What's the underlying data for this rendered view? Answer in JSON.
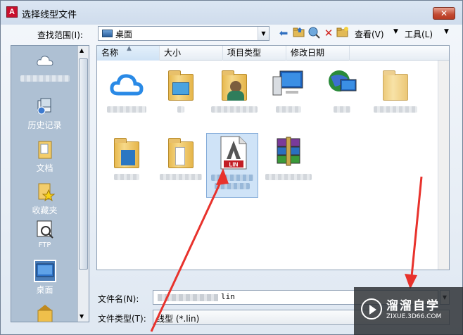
{
  "window": {
    "title": "选择线型文件",
    "app_icon": "A",
    "close_label": "✕"
  },
  "toolbar": {
    "location_label": "查找范围(I):",
    "location_value": "桌面",
    "view_label": "查看(V)",
    "tools_label": "工具(L)",
    "icons": [
      "back-icon",
      "up-folder-icon",
      "search-web-icon",
      "delete-icon",
      "new-folder-icon",
      "views-icon",
      "tools-icon"
    ]
  },
  "places": [
    {
      "name": "cloud",
      "label": ""
    },
    {
      "name": "history",
      "label": "历史记录"
    },
    {
      "name": "documents",
      "label": "文档"
    },
    {
      "name": "favorites",
      "label": "收藏夹"
    },
    {
      "name": "ftp",
      "label": "FTP"
    },
    {
      "name": "desktop",
      "label": "桌面"
    }
  ],
  "columns": [
    "名称",
    "大小",
    "项目类型",
    "修改日期"
  ],
  "files": [
    {
      "icon": "cloud-icon",
      "selected": false
    },
    {
      "icon": "library-folder-icon",
      "selected": false
    },
    {
      "icon": "user-folder-icon",
      "selected": false
    },
    {
      "icon": "computer-icon",
      "selected": false
    },
    {
      "icon": "network-icon",
      "selected": false
    },
    {
      "icon": "folder-icon",
      "selected": false
    },
    {
      "icon": "folder-icon",
      "selected": false
    },
    {
      "icon": "folder-icon",
      "selected": false
    },
    {
      "icon": "lin-file-icon",
      "selected": true,
      "badge": "LIN"
    },
    {
      "icon": "winrar-icon",
      "selected": false
    }
  ],
  "filename": {
    "label": "文件名(N):",
    "value": "lin"
  },
  "filetype": {
    "label": "文件类型(T):",
    "value": "线型 (*.lin)"
  },
  "watermark": {
    "title": "溜溜自学",
    "url": "ZIXUE.3D66.COM"
  },
  "colors": {
    "accent": "#e8322c",
    "selection": "#cfe3f7"
  }
}
